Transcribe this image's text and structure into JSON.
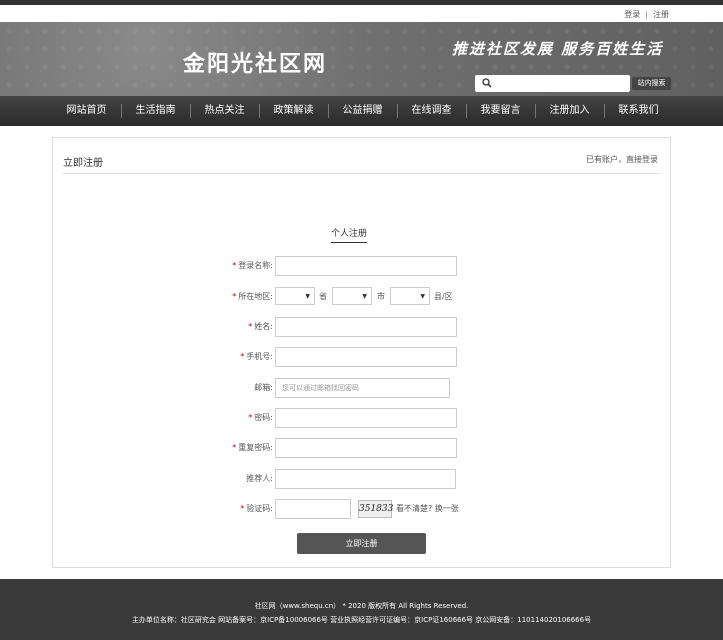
{
  "top_links": {
    "login": "登录",
    "separator": "|",
    "register": "注册"
  },
  "header": {
    "logo": "金阳光社区网",
    "slogan": "推进社区发展 服务百姓生活",
    "search_button": "站内搜索"
  },
  "nav": [
    "网站首页",
    "生活指南",
    "热点关注",
    "政策解读",
    "公益捐赠",
    "在线调查",
    "我要留言",
    "注册加入",
    "联系我们"
  ],
  "card": {
    "title": "立即注册",
    "login_hint": "已有账户，直接登录",
    "section_title": "个人注册"
  },
  "form": {
    "username_label": "登录名称:",
    "region_label": "所在地区:",
    "province_unit": "省",
    "city_unit": "市",
    "county_unit": "县/区",
    "name_label": "姓名:",
    "phone_label": "手机号:",
    "email_label": "邮箱:",
    "email_placeholder": "您可以通过邮箱找回密码",
    "password_label": "密码:",
    "repeat_password_label": "重复密码:",
    "referrer_label": "推荐人:",
    "captcha_label": "验证码:",
    "captcha_text": "351833",
    "captcha_hint": "看不清楚? 换一张",
    "submit": "立即注册",
    "required_mark": "*"
  },
  "footer": {
    "line1": "社区网（www.shequ.cn） * 2020 版权所有 All Rights Reserved.",
    "line2": "主办单位名称：社区研究会 网站备案号：京ICP备10006066号 营业执照经营许可证编号：京ICP证160666号 京公网安备：110114020106666号"
  }
}
